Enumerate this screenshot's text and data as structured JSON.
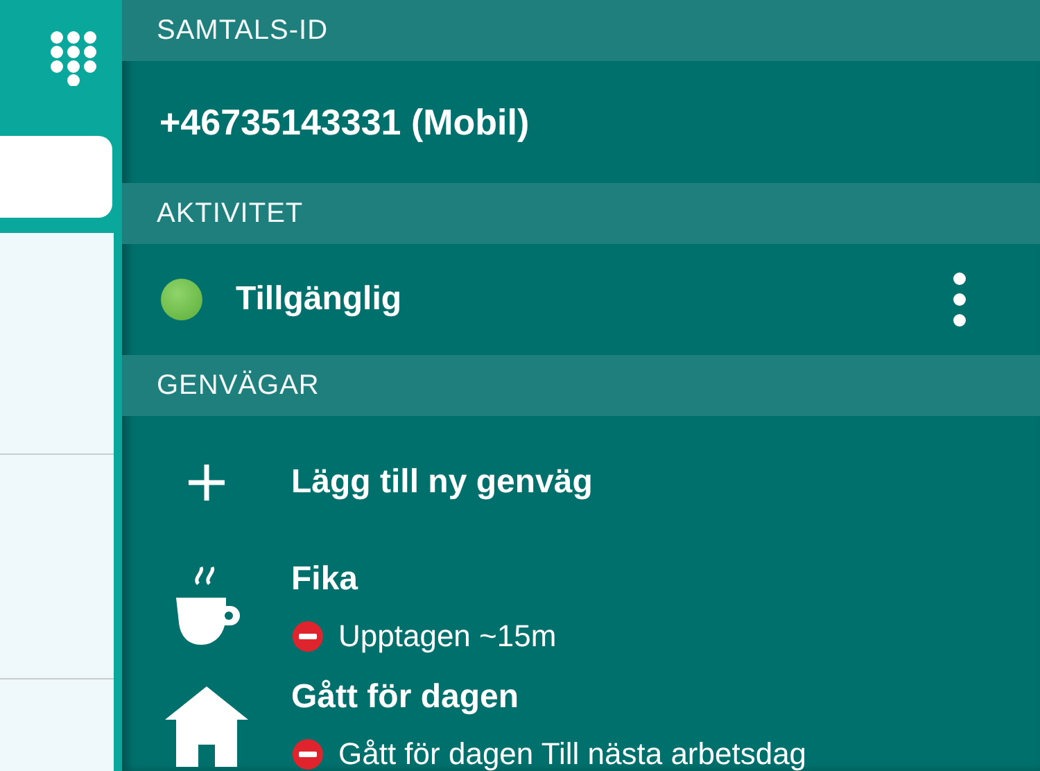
{
  "sections": [
    {
      "kind": "caller_id",
      "header": "SAMTALS-ID",
      "value": "+46735143331 (Mobil)"
    },
    {
      "kind": "activity",
      "header": "AKTIVITET",
      "status": {
        "kind": "available",
        "label": "Tillgänglig"
      }
    },
    {
      "kind": "shortcuts",
      "header": "GENVÄGAR",
      "items": [
        {
          "kind": "add",
          "title": "Lägg till ny genväg"
        },
        {
          "kind": "coffee",
          "title": "Fika",
          "status": {
            "kind": "busy",
            "label": "Upptagen ~15m"
          }
        },
        {
          "kind": "home",
          "title": "Gått för dagen",
          "status": {
            "kind": "busy",
            "label": "Gått för dagen Till nästa arbetsdag"
          }
        }
      ]
    }
  ]
}
